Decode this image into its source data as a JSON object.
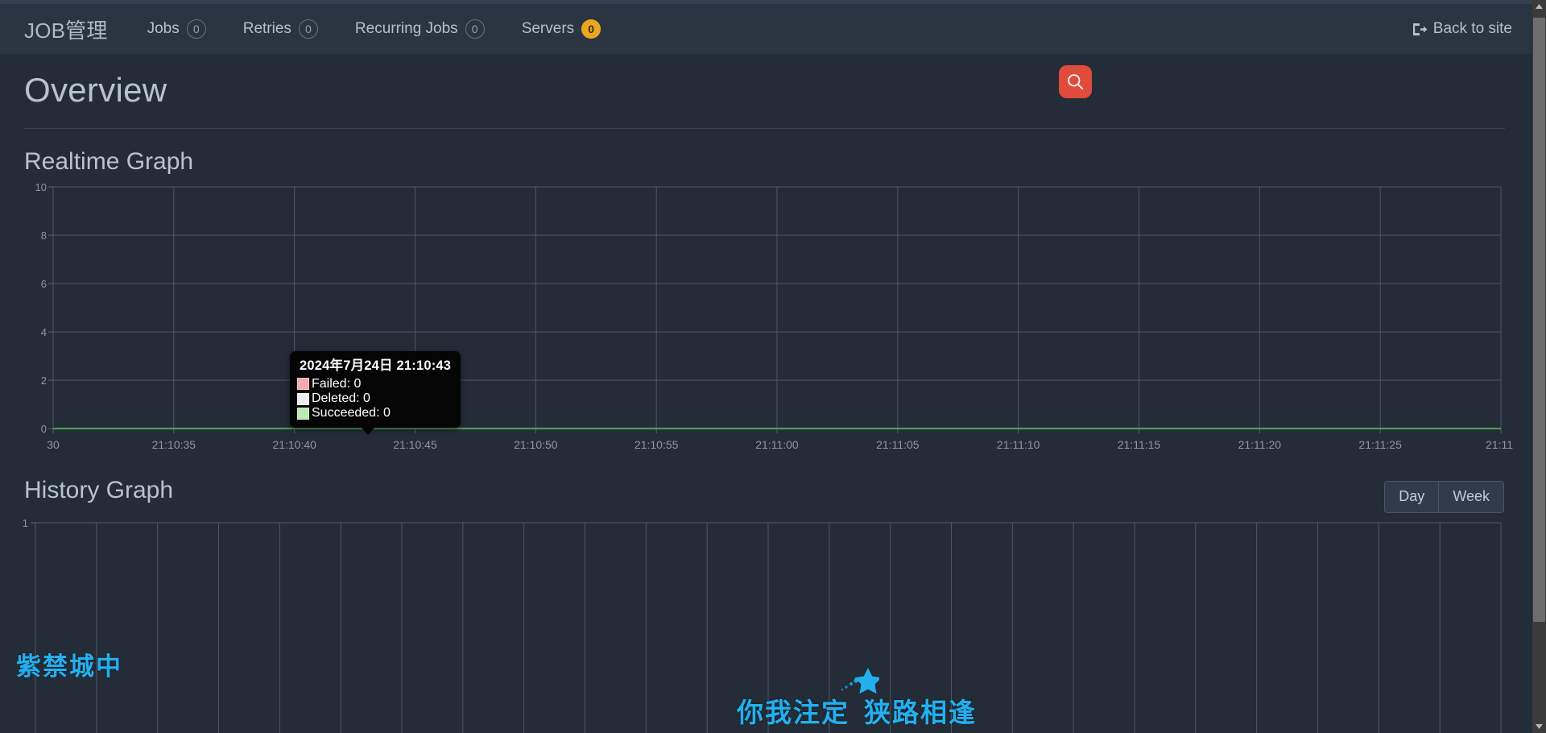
{
  "navbar": {
    "brand": "JOB管理",
    "items": [
      {
        "label": "Jobs",
        "badge": "0",
        "badge_style": "outline"
      },
      {
        "label": "Retries",
        "badge": "0",
        "badge_style": "outline"
      },
      {
        "label": "Recurring Jobs",
        "badge": "0",
        "badge_style": "outline"
      },
      {
        "label": "Servers",
        "badge": "0",
        "badge_style": "amber"
      }
    ],
    "back_to_site": "Back to site",
    "back_icon": "sign-out-icon"
  },
  "page": {
    "title": "Overview",
    "search_icon": "search-icon"
  },
  "realtime": {
    "title": "Realtime Graph"
  },
  "history": {
    "title": "History Graph",
    "range_buttons": [
      {
        "label": "Day"
      },
      {
        "label": "Week"
      }
    ]
  },
  "tooltip": {
    "timestamp": "2024年7月24日 21:10:43",
    "rows": [
      {
        "label": "Failed: 0",
        "color": "#f4a8b4"
      },
      {
        "label": "Deleted: 0",
        "color": "#ededed"
      },
      {
        "label": "Succeeded: 0",
        "color": "#bbe8b5"
      }
    ]
  },
  "watermarks": {
    "left": "紫禁城中",
    "center_part1": "你我注定",
    "center_part2": "狭路相逢",
    "color": "#22b0f0",
    "star_icon": "star-icon"
  },
  "colors": {
    "page_background": "#242c38",
    "navbar_background": "#2b3441",
    "accent_red": "#e14b3b",
    "accent_amber": "#eda621",
    "grid_line": "#5b6574",
    "succeeded_line": "#4a9e52",
    "text_muted": "#8d97a3"
  },
  "chart_data": [
    {
      "type": "line",
      "name": "realtime-graph",
      "title": "Realtime Graph",
      "xlabel": "",
      "ylabel": "",
      "ylim": [
        0,
        10
      ],
      "yticks": [
        0,
        2,
        4,
        6,
        8,
        10
      ],
      "ytick_labels": [
        "0",
        "2",
        "4",
        "6",
        "8",
        "10"
      ],
      "xtick_labels": [
        "30",
        "21:10:35",
        "21:10:40",
        "21:10:45",
        "21:10:50",
        "21:10:55",
        "21:11:00",
        "21:11:05",
        "21:11:10",
        "21:11:15",
        "21:11:20",
        "21:11:25",
        "21:11:"
      ],
      "grid": true,
      "series": [
        {
          "name": "Failed",
          "color": "#f4a8b4",
          "values": [
            0,
            0,
            0,
            0,
            0,
            0,
            0,
            0,
            0,
            0,
            0,
            0,
            0
          ]
        },
        {
          "name": "Deleted",
          "color": "#ededed",
          "values": [
            0,
            0,
            0,
            0,
            0,
            0,
            0,
            0,
            0,
            0,
            0,
            0,
            0
          ]
        },
        {
          "name": "Succeeded",
          "color": "#4a9e52",
          "values": [
            0,
            0,
            0,
            0,
            0,
            0,
            0,
            0,
            0,
            0,
            0,
            0,
            0
          ]
        }
      ]
    },
    {
      "type": "line",
      "name": "history-graph",
      "title": "History Graph",
      "xlabel": "",
      "ylabel": "",
      "ylim": [
        0,
        1
      ],
      "yticks": [
        1
      ],
      "ytick_labels": [
        "1"
      ],
      "xtick_labels": [],
      "grid": true,
      "gridline_count": 24,
      "series": [
        {
          "name": "Succeeded",
          "color": "#4a9e52",
          "values": []
        }
      ]
    }
  ]
}
